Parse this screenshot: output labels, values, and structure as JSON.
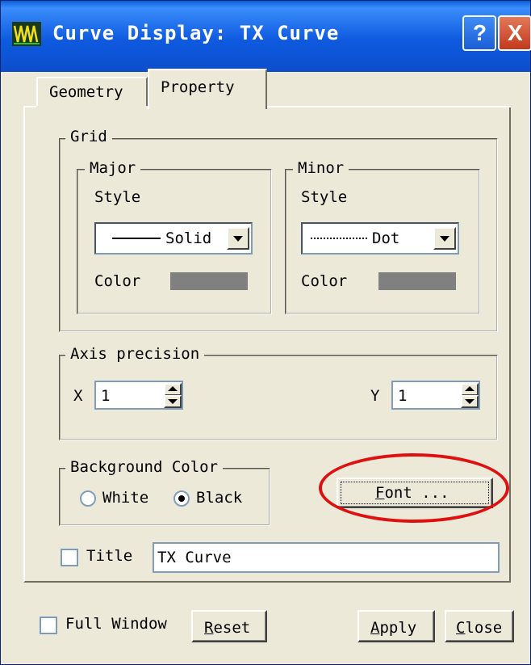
{
  "window": {
    "title": "Curve Display: TX Curve",
    "colors": {
      "titlebar": "#0b4ecc",
      "face": "#ece9d8",
      "swatch": "#808080",
      "highlight": "#e01010"
    },
    "help_icon": "?",
    "close_icon": "X"
  },
  "tabs": [
    {
      "label": "Geometry",
      "selected": false
    },
    {
      "label": "Property",
      "selected": true
    }
  ],
  "grid": {
    "title": "Grid",
    "major": {
      "title": "Major",
      "style_label": "Style",
      "style_value": "Solid",
      "color_label": "Color"
    },
    "minor": {
      "title": "Minor",
      "style_label": "Style",
      "style_value": "Dot",
      "color_label": "Color"
    }
  },
  "axis_precision": {
    "title": "Axis precision",
    "x_label": "X",
    "x_value": "1",
    "y_label": "Y",
    "y_value": "1"
  },
  "background_color": {
    "title": "Background Color",
    "options": [
      {
        "label": "White",
        "selected": false
      },
      {
        "label": "Black",
        "selected": true
      }
    ]
  },
  "font_button": {
    "mnemonic": "F",
    "rest": "ont ..."
  },
  "title_option": {
    "label": "Title",
    "checked": false,
    "value": "TX Curve"
  },
  "footer": {
    "full_window_label": "Full Window",
    "full_window_checked": false,
    "reset": {
      "mnemonic": "R",
      "rest": "eset"
    },
    "apply": {
      "mnemonic": "A",
      "rest": "pply"
    },
    "close": {
      "mnemonic": "C",
      "rest": "lose"
    }
  }
}
